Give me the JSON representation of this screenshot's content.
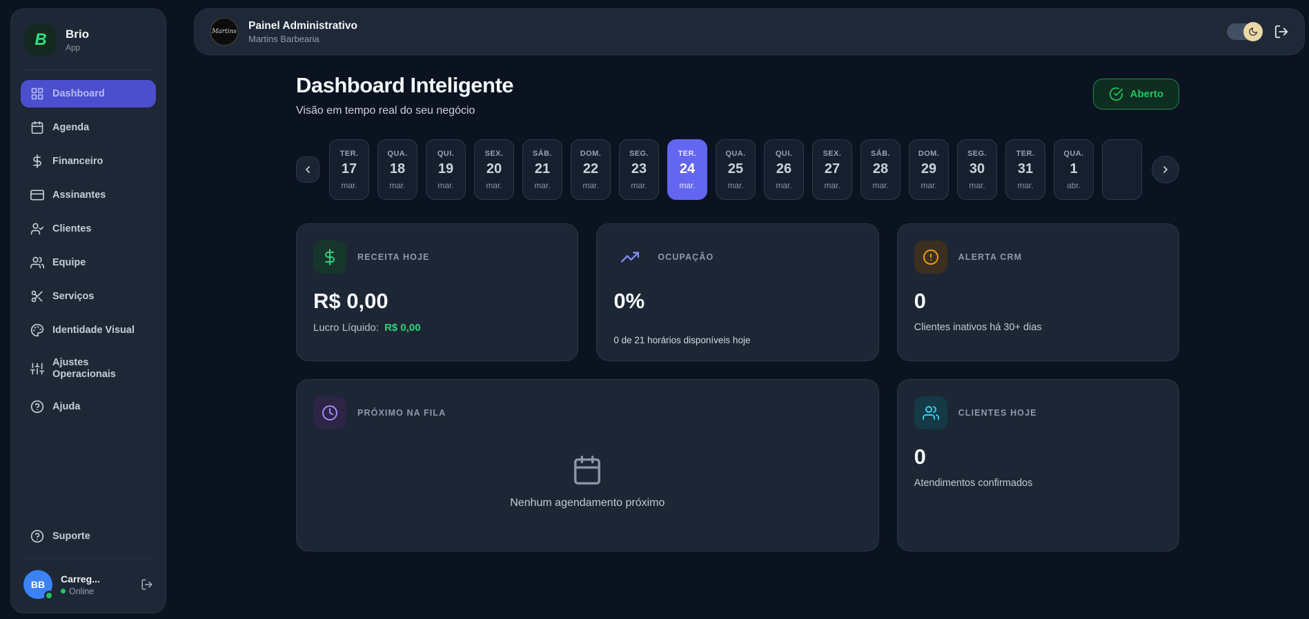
{
  "colors": {
    "accent_indigo": "#6366f1",
    "active_nav": "#4b4ecd",
    "green": "#22c55e",
    "orange": "#f59e0b",
    "purple": "#a78bfa",
    "teal": "#2dd4ee",
    "avatar_blue": "#3b82f6",
    "toggle_knob": "#ead9a6"
  },
  "sidebar": {
    "logo": {
      "mark": "B",
      "title": "Brio",
      "subtitle": "App"
    },
    "items": [
      {
        "label": "Dashboard"
      },
      {
        "label": "Agenda"
      },
      {
        "label": "Financeiro"
      },
      {
        "label": "Assinantes"
      },
      {
        "label": "Clientes"
      },
      {
        "label": "Equipe"
      },
      {
        "label": "Serviços"
      },
      {
        "label": "Identidade Visual"
      },
      {
        "label": "Ajustes Operacionais"
      },
      {
        "label": "Ajuda"
      }
    ],
    "support": {
      "label": "Suporte"
    },
    "user": {
      "initials": "BB",
      "name": "Carreg...",
      "status": "Online"
    }
  },
  "topbar": {
    "logo_text": "Martins",
    "title": "Painel Administrativo",
    "subtitle": "Martins Barbearia"
  },
  "header": {
    "title": "Dashboard Inteligente",
    "subtitle": "Visão em tempo real do seu negócio",
    "status": "Aberto"
  },
  "date_carousel": {
    "selected_index": 7,
    "days": [
      {
        "dow": "TER.",
        "day": "17",
        "month": "mar."
      },
      {
        "dow": "QUA.",
        "day": "18",
        "month": "mar."
      },
      {
        "dow": "QUI.",
        "day": "19",
        "month": "mar."
      },
      {
        "dow": "SEX.",
        "day": "20",
        "month": "mar."
      },
      {
        "dow": "SÁB.",
        "day": "21",
        "month": "mar."
      },
      {
        "dow": "DOM.",
        "day": "22",
        "month": "mar."
      },
      {
        "dow": "SEG.",
        "day": "23",
        "month": "mar."
      },
      {
        "dow": "TER.",
        "day": "24",
        "month": "mar."
      },
      {
        "dow": "QUA.",
        "day": "25",
        "month": "mar."
      },
      {
        "dow": "QUI.",
        "day": "26",
        "month": "mar."
      },
      {
        "dow": "SEX.",
        "day": "27",
        "month": "mar."
      },
      {
        "dow": "SÁB.",
        "day": "28",
        "month": "mar."
      },
      {
        "dow": "DOM.",
        "day": "29",
        "month": "mar."
      },
      {
        "dow": "SEG.",
        "day": "30",
        "month": "mar."
      },
      {
        "dow": "TER.",
        "day": "31",
        "month": "mar."
      },
      {
        "dow": "QUA.",
        "day": "1",
        "month": "abr."
      }
    ]
  },
  "cards": {
    "receita": {
      "label": "RECEITA HOJE",
      "value": "R$ 0,00",
      "profit_label": "Lucro Líquido:",
      "profit_value": "R$ 0,00"
    },
    "ocupacao": {
      "label": "OCUPAÇÃO",
      "value": "0%",
      "progress_percent": 0,
      "subtitle": "0 de 21 horários disponíveis hoje"
    },
    "alerta": {
      "label": "ALERTA CRM",
      "value": "0",
      "subtitle": "Clientes inativos há 30+ dias"
    },
    "fila": {
      "label": "PRÓXIMO NA FILA",
      "empty": "Nenhum agendamento próximo"
    },
    "clientes": {
      "label": "CLIENTES HOJE",
      "value": "0",
      "subtitle": "Atendimentos confirmados"
    }
  }
}
